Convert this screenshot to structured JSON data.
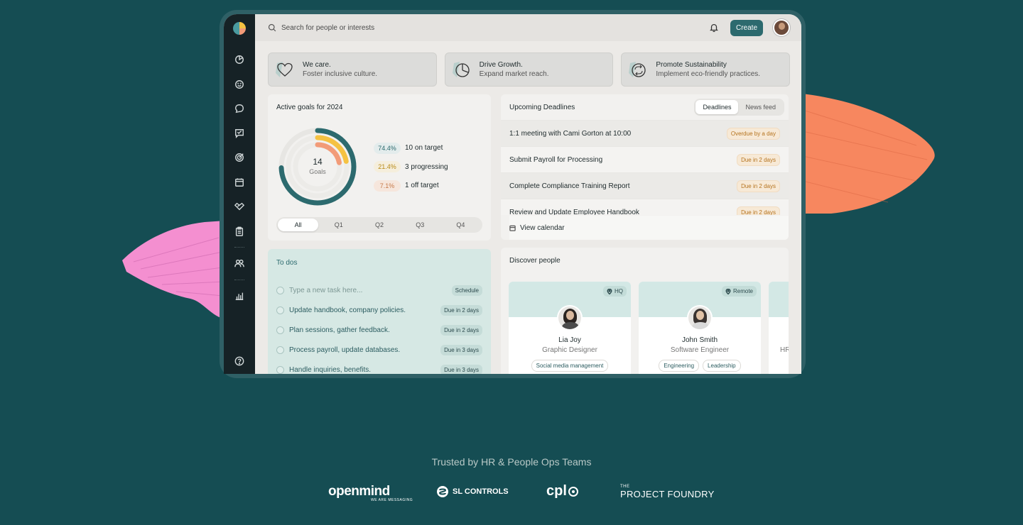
{
  "colors": {
    "page_bg": "#154d53",
    "accent": "#2c6a6e",
    "goal_teal": "#2c6a6e",
    "goal_yellow": "#f5c242",
    "goal_orange": "#f29b78",
    "blob_pink": "#f48fd0",
    "blob_orange": "#f7875f"
  },
  "topbar": {
    "search_placeholder": "Search for people or interests",
    "search_icon": "search-icon",
    "bell_icon": "bell-icon",
    "create_label": "Create"
  },
  "sidebar": {
    "items": [
      "dashboard-icon",
      "smile-icon",
      "chat-icon",
      "feedback-icon",
      "target-icon",
      "calendar-icon",
      "handshake-icon",
      "clipboard-icon",
      "people-icon",
      "bar-chart-icon"
    ],
    "help_icon": "help-icon"
  },
  "values": [
    {
      "title": "We care.",
      "subtitle": "Foster inclusive culture.",
      "icon": "heart-icon"
    },
    {
      "title": "Drive Growth.",
      "subtitle": "Expand market reach.",
      "icon": "pie-icon"
    },
    {
      "title": "Promote Sustainability",
      "subtitle": "Implement eco-friendly practices.",
      "icon": "recycle-icon"
    }
  ],
  "goals": {
    "title": "Active goals for 2024",
    "count": "14",
    "count_label": "Goals",
    "legend": [
      {
        "pct": "74.4%",
        "label": "10 on target",
        "value": 0.744
      },
      {
        "pct": "21.4%",
        "label": "3 progressing",
        "value": 0.214
      },
      {
        "pct": "7.1%",
        "label": "1 off target",
        "value": 0.071
      }
    ],
    "quarters": [
      "All",
      "Q1",
      "Q2",
      "Q3",
      "Q4"
    ],
    "active_quarter": "All"
  },
  "deadlines": {
    "title": "Upcoming Deadlines",
    "tabs": [
      "Deadlines",
      "News feed"
    ],
    "active_tab": "Deadlines",
    "items": [
      {
        "task": "1:1 meeting with Cami Gorton at 10:00",
        "due": "Overdue by a day"
      },
      {
        "task": "Submit Payroll for Processing",
        "due": "Due in 2 days"
      },
      {
        "task": "Complete Compliance Training Report",
        "due": "Due in 2 days"
      },
      {
        "task": "Review and Update Employee Handbook",
        "due": "Due in 2 days"
      }
    ],
    "view_calendar": "View calendar"
  },
  "todos": {
    "title": "To dos",
    "input_placeholder": "Type a new task here...",
    "schedule_label": "Schedule",
    "items": [
      {
        "task": "Update handbook, company policies.",
        "due": "Due in 2 days"
      },
      {
        "task": "Plan sessions, gather feedback.",
        "due": "Due in 2 days"
      },
      {
        "task": "Process payroll, update databases.",
        "due": "Due in 3 days"
      },
      {
        "task": "Handle inquiries, benefits.",
        "due": "Due in 3 days"
      }
    ]
  },
  "discover": {
    "title": "Discover people",
    "people": [
      {
        "name": "Lia Joy",
        "role": "Graphic Designer",
        "location": "HQ",
        "tags": [
          "Social media management"
        ]
      },
      {
        "name": "John Smith",
        "role": "Software Engineer",
        "location": "Remote",
        "tags": [
          "Engineering",
          "Leadership"
        ]
      }
    ],
    "partial_role": "HR"
  },
  "trusted": {
    "heading": "Trusted by HR & People Ops Teams",
    "logos": {
      "openmind": "openmind",
      "openmind_tagline": "WE ARE MESSAGING",
      "sl": "SL CONTROLS",
      "cpl": "cpl",
      "pf_small": "THE",
      "pf": "PROJECT FOUNDRY"
    }
  }
}
